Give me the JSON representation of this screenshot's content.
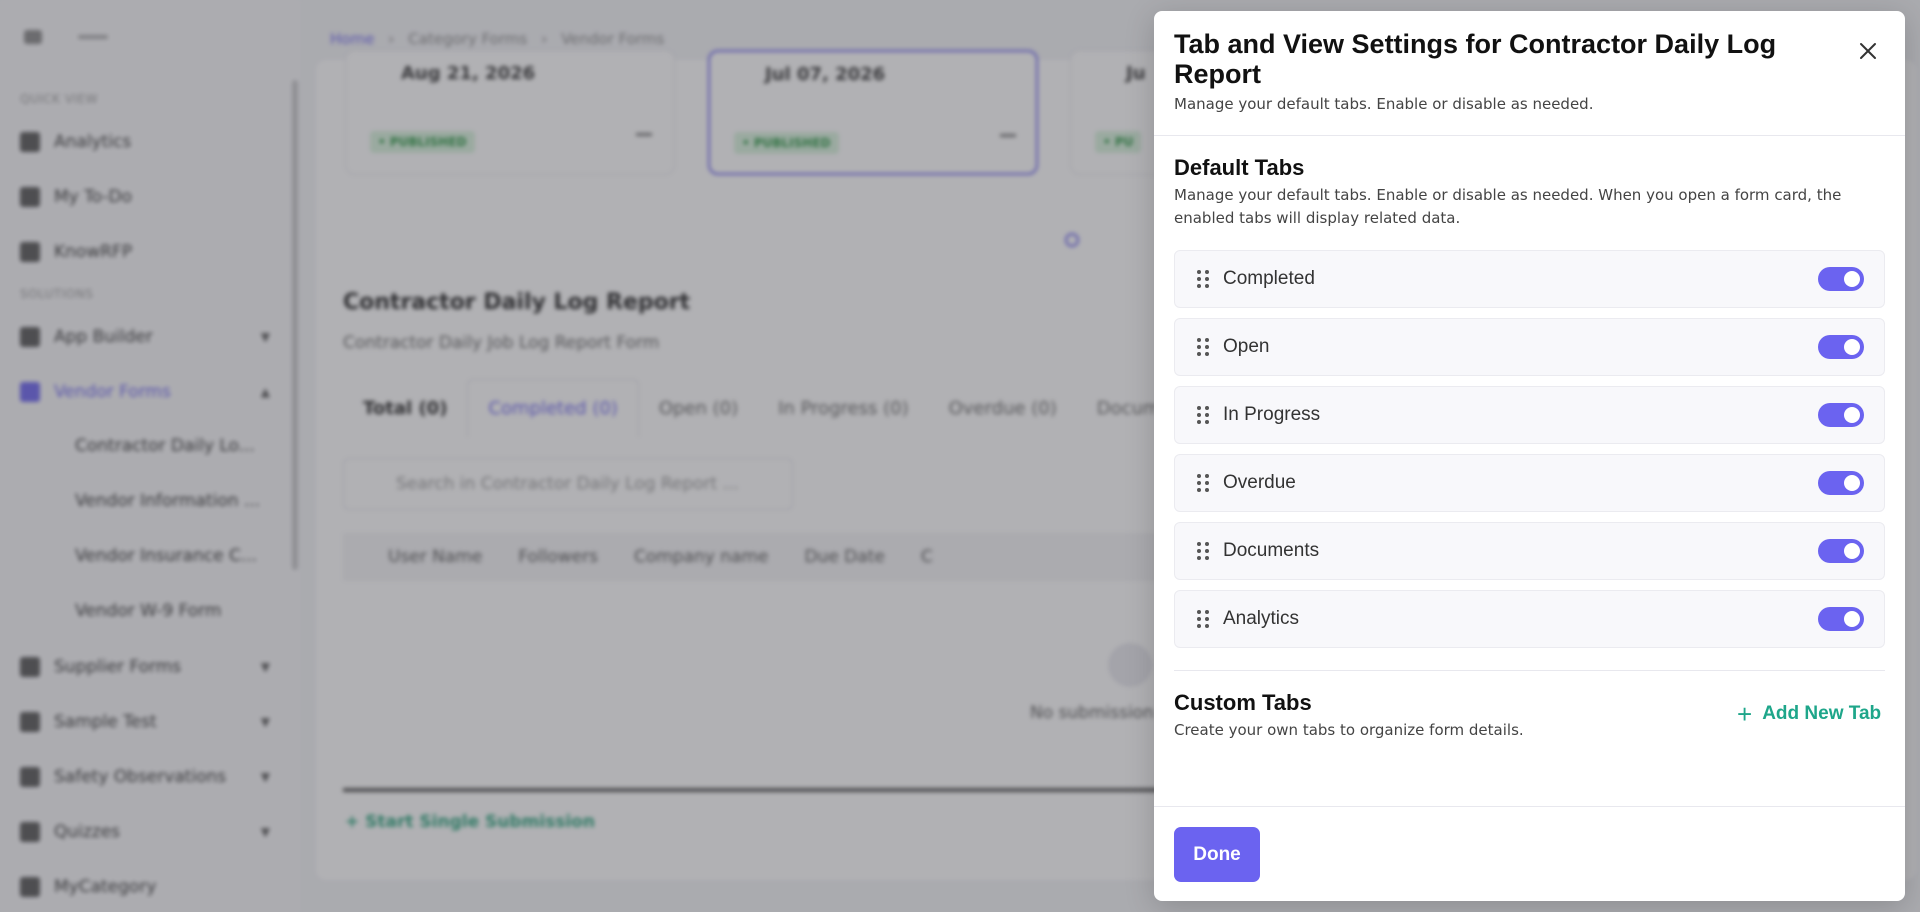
{
  "background": {
    "breadcrumb": [
      "Home",
      "Category Forms",
      "Vendor Forms"
    ],
    "sidebar": {
      "quick_view_label": "QUICK VIEW",
      "quick_items": [
        "Analytics",
        "My To-Do",
        "KnowRFP"
      ],
      "solutions_label": "SOLUTIONS",
      "app_builder": "App Builder",
      "vendor_forms": "Vendor Forms",
      "vendor_sub": [
        "Contractor Daily Lo...",
        "Vendor Information ...",
        "Vendor Insurance C...",
        "Vendor W-9 Form"
      ],
      "other_items": [
        "Supplier Forms",
        "Sample Test",
        "Safety Observations",
        "Quizzes",
        "MyCategory"
      ]
    },
    "cards": [
      {
        "date": "Aug 21, 2026",
        "status": "• PUBLISHED"
      },
      {
        "date": "Jul 07, 2026",
        "status": "• PUBLISHED"
      },
      {
        "date": "Ju",
        "status": "• PU"
      }
    ],
    "page_title": "Contractor Daily Log Report",
    "page_subtitle": "Contractor Daily Job Log Report Form",
    "tabs": [
      "Total (0)",
      "Completed (0)",
      "Open (0)",
      "In Progress (0)",
      "Overdue (0)",
      "Docum"
    ],
    "search_placeholder": "Search in Contractor Daily Log Report ...",
    "columns": [
      "User Name",
      "Followers",
      "Company name",
      "Due Date",
      "C"
    ],
    "empty_text": "No submission",
    "start_link": "+ Start Single Submission"
  },
  "modal": {
    "title": "Tab and View Settings for Contractor Daily Log Report",
    "subtitle": "Manage your default tabs. Enable or disable as needed.",
    "default_tabs": {
      "heading": "Default Tabs",
      "description": "Manage your default tabs. Enable or disable as needed. When you open a form card, the enabled tabs will display related data.",
      "items": [
        {
          "label": "Completed",
          "enabled": true
        },
        {
          "label": "Open",
          "enabled": true
        },
        {
          "label": "In Progress",
          "enabled": true
        },
        {
          "label": "Overdue",
          "enabled": true
        },
        {
          "label": "Documents",
          "enabled": true
        },
        {
          "label": "Analytics",
          "enabled": true
        }
      ]
    },
    "custom_tabs": {
      "heading": "Custom Tabs",
      "description": "Create your own tabs to organize form details.",
      "add_label": "Add New Tab"
    },
    "done_label": "Done"
  },
  "colors": {
    "accent": "#6b63f0",
    "add_link": "#1ea68a",
    "published_badge": "#26943f"
  },
  "icons": [
    "close-icon",
    "drag-handle-icon",
    "plus-icon",
    "chevron-down-icon",
    "search-icon",
    "filter-icon"
  ]
}
